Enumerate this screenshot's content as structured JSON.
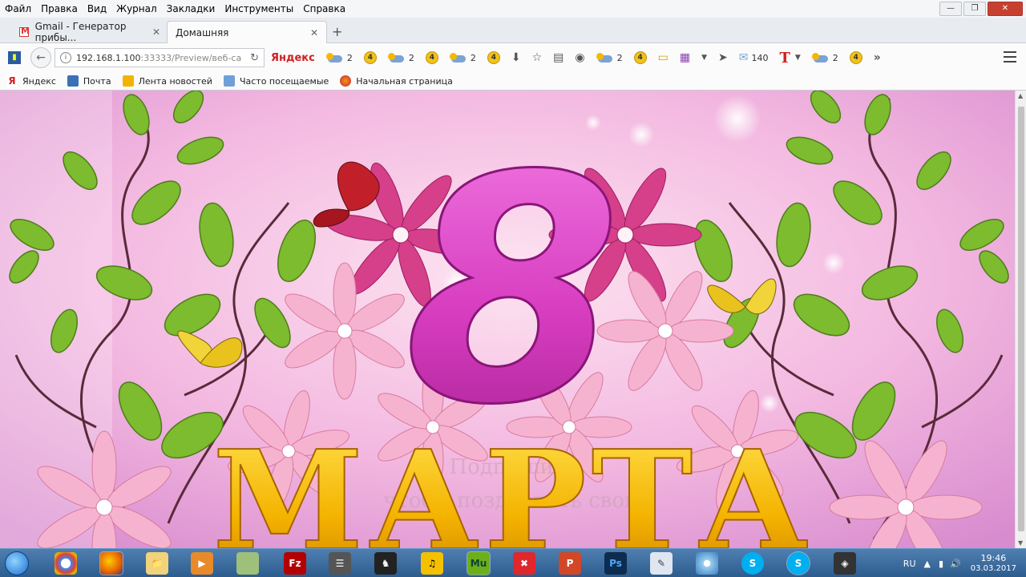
{
  "menu": [
    "Файл",
    "Правка",
    "Вид",
    "Журнал",
    "Закладки",
    "Инструменты",
    "Справка"
  ],
  "tabs": [
    {
      "label": "Gmail - Генератор прибы...",
      "active": false
    },
    {
      "label": "Домашняя",
      "active": true
    }
  ],
  "url": {
    "host": "192.168.1.100",
    "rest": ":33333/Preview/веб-са"
  },
  "toolbar": {
    "yandex": "Яндекс",
    "items": [
      "2",
      "2",
      "2",
      "2",
      "140",
      "2"
    ]
  },
  "bookmarks": [
    "Яндекс",
    "Почта",
    "Лента новостей",
    "Часто посещаемые",
    "Начальная страница"
  ],
  "page": {
    "big_number": "8",
    "word": "МАРТА",
    "watermark_line1": "Подпишись",
    "watermark_line2": "чтобы поздравить свою",
    "colors": {
      "pink": "#d84bc4",
      "gold": "#f2b400",
      "leaf": "#7dbb2f"
    }
  },
  "taskbar": {
    "lang": "RU",
    "time": "19:46",
    "date": "03.03.2017",
    "apps": [
      "chrome",
      "firefox",
      "explorer",
      "media-player",
      "notes",
      "filezilla",
      "books",
      "game",
      "headphones",
      "muse",
      "xmind",
      "powerpoint",
      "photoshop",
      "document",
      "disc",
      "skype",
      "skype-2",
      "camera"
    ]
  }
}
